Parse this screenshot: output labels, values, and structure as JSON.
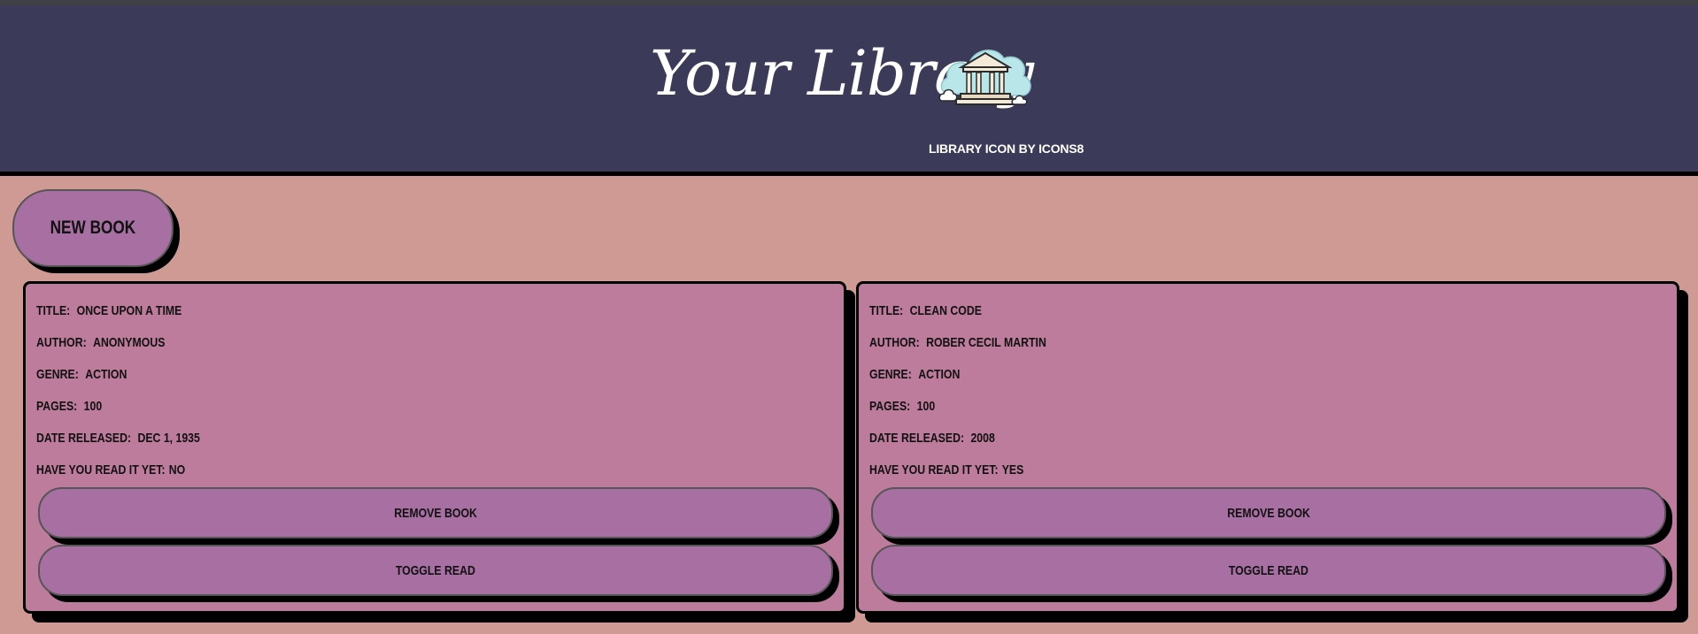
{
  "header": {
    "title": "Your Library",
    "credit": "Library icon by Icons8",
    "logo_icon": "library-building-icon"
  },
  "toolbar": {
    "new_book_label": "New Book"
  },
  "colors": {
    "header_bg": "#3b3a59",
    "page_bg": "#cf9a93",
    "card_bg": "#bd7c9c",
    "button_bg": "#a86fa3"
  },
  "books": [
    {
      "title_label": "Title:",
      "title": "Once upon a time",
      "author_label": "Author:",
      "author": "Anonymous",
      "genre_label": "Genre:",
      "genre": "Action",
      "pages_label": "Pages:",
      "pages": "100",
      "released_label": "Date Released:",
      "released": "Dec 1, 1935",
      "read_label": "Have you read it yet:",
      "read": "No",
      "remove_label": "Remove Book",
      "toggle_label": "Toggle Read"
    },
    {
      "title_label": "Title:",
      "title": "Clean Code",
      "author_label": "Author:",
      "author": "Rober Cecil Martin",
      "genre_label": "Genre:",
      "genre": "Action",
      "pages_label": "Pages:",
      "pages": "100",
      "released_label": "Date Released:",
      "released": "2008",
      "read_label": "Have you read it yet:",
      "read": "Yes",
      "remove_label": "Remove Book",
      "toggle_label": "Toggle Read"
    }
  ]
}
